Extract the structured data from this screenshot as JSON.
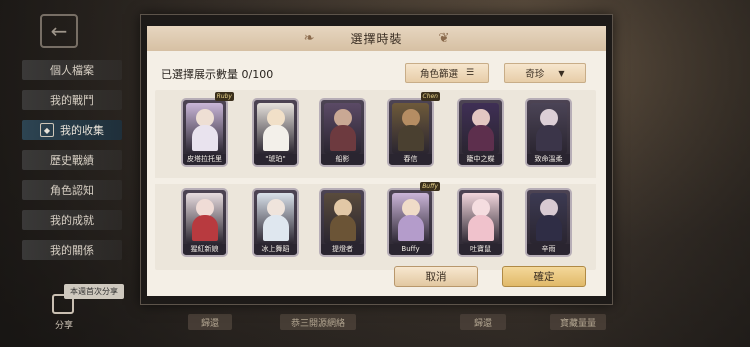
{
  "modal": {
    "title": "選擇時裝",
    "selected_count_label": "已選擇展示數量 0/100",
    "filter_label": "角色篩選",
    "sort_label": "奇珍",
    "cancel_label": "取消",
    "confirm_label": "確定"
  },
  "sidebar": {
    "items": [
      {
        "label": "個人檔案"
      },
      {
        "label": "我的戰鬥"
      },
      {
        "label": "我的收集"
      },
      {
        "label": "歷史戰績"
      },
      {
        "label": "角色認知"
      },
      {
        "label": "我的成就"
      },
      {
        "label": "我的關係"
      }
    ]
  },
  "share": {
    "tip": "本週首次分享",
    "label": "分享"
  },
  "costumes": [
    {
      "name": "皮塔拉托里",
      "tag": "Ruby",
      "art": "#c9b6d8",
      "skin": "#eedfd4",
      "body": "#e9e3ee"
    },
    {
      "name": "\"琥珀\"",
      "tag": "",
      "art": "#e6e2dc",
      "skin": "#f1e0c8",
      "body": "#f3f0ea"
    },
    {
      "name": "船影",
      "tag": "",
      "art": "#5b4a66",
      "skin": "#c9a894",
      "body": "#6d3a3f"
    },
    {
      "name": "春信",
      "tag": "Chen",
      "art": "#6e5a3a",
      "skin": "#b58d63",
      "body": "#4a4030"
    },
    {
      "name": "籠中之蝶",
      "tag": "",
      "art": "#3f2f55",
      "skin": "#e3c7c2",
      "body": "#5d2f4d"
    },
    {
      "name": "致命溫柔",
      "tag": "",
      "art": "#4b4456",
      "skin": "#dccfd6",
      "body": "#3b3549"
    },
    {
      "name": "猩紅新娘",
      "tag": "",
      "art": "#e7dcdf",
      "skin": "#f0dcd6",
      "body": "#b83a3f"
    },
    {
      "name": "冰上舞蹈",
      "tag": "",
      "art": "#d9e1ea",
      "skin": "#efe4dc",
      "body": "#dfe7ef"
    },
    {
      "name": "提燈者",
      "tag": "",
      "art": "#594b3c",
      "skin": "#e2c8a6",
      "body": "#6b5436"
    },
    {
      "name": "Buffy",
      "tag": "Buffy",
      "art": "#cbb5d8",
      "skin": "#f0dcc8",
      "body": "#b49ccb"
    },
    {
      "name": "吐寶鼠",
      "tag": "",
      "art": "#f2d6dc",
      "skin": "#f5dde0",
      "body": "#f0c2cc"
    },
    {
      "name": "辛雨",
      "tag": "",
      "art": "#3c3a52",
      "skin": "#d8cad2",
      "body": "#2f2d45"
    }
  ],
  "bottom_strip": {
    "left": "歸還",
    "mid": "恭三開源網絡",
    "right1": "歸還",
    "right2": "寶藏量量"
  }
}
